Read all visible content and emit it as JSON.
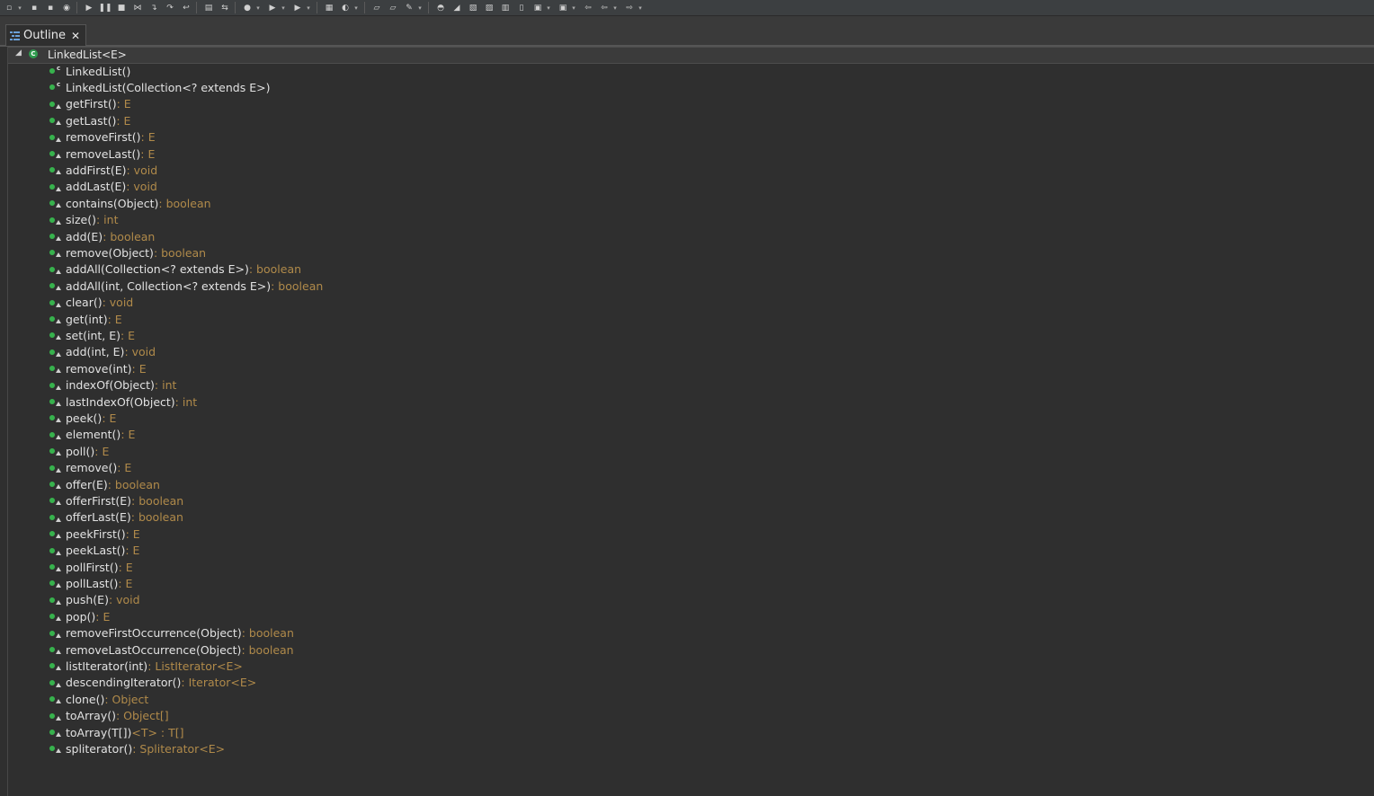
{
  "toolbar": {
    "buttons": [
      {
        "icon": "new-icon",
        "glyph": "▫",
        "dropdown": true
      },
      {
        "icon": "save-icon",
        "glyph": "▪"
      },
      {
        "icon": "save-all-icon",
        "glyph": "▪"
      },
      {
        "icon": "print-icon",
        "glyph": "◉"
      },
      {
        "sep": true
      },
      {
        "icon": "resume-icon",
        "glyph": "▶"
      },
      {
        "icon": "suspend-icon",
        "glyph": "❚❚"
      },
      {
        "icon": "terminate-icon",
        "glyph": "■"
      },
      {
        "icon": "disconnect-icon",
        "glyph": "⋈"
      },
      {
        "icon": "step-into-icon",
        "glyph": "↴"
      },
      {
        "icon": "step-over-icon",
        "glyph": "↷"
      },
      {
        "icon": "step-return-icon",
        "glyph": "↩"
      },
      {
        "sep": true
      },
      {
        "icon": "open-console-icon",
        "glyph": "▤"
      },
      {
        "icon": "use-step-filters-icon",
        "glyph": "⇆"
      },
      {
        "sep": true
      },
      {
        "icon": "debug-icon",
        "glyph": "●",
        "dropdown": true
      },
      {
        "icon": "run-icon",
        "glyph": "▶",
        "dropdown": true
      },
      {
        "icon": "external-tools-icon",
        "glyph": "▶",
        "dropdown": true
      },
      {
        "sep": true
      },
      {
        "icon": "new-java-project-icon",
        "glyph": "▦"
      },
      {
        "icon": "new-class-icon",
        "glyph": "◐",
        "dropdown": true
      },
      {
        "sep": true
      },
      {
        "icon": "open-type-icon",
        "glyph": "▱"
      },
      {
        "icon": "open-task-icon",
        "glyph": "▱"
      },
      {
        "icon": "search-icon",
        "glyph": "✎",
        "dropdown": true
      },
      {
        "sep": true
      },
      {
        "icon": "toggle-breadcrumb-icon",
        "glyph": "◓"
      },
      {
        "icon": "toggle-mark-occurrences-icon",
        "glyph": "◢"
      },
      {
        "icon": "toggle-block-selection-icon",
        "glyph": "▧"
      },
      {
        "icon": "show-whitespace-icon",
        "glyph": "▨"
      },
      {
        "icon": "show-source-icon",
        "glyph": "▥"
      },
      {
        "icon": "show-selected-element-icon",
        "glyph": "▯"
      },
      {
        "icon": "next-annotation-icon",
        "glyph": "▣",
        "dropdown": true
      },
      {
        "icon": "previous-annotation-icon",
        "glyph": "▣",
        "dropdown": true
      },
      {
        "icon": "last-edit-location-icon",
        "glyph": "⇦"
      },
      {
        "icon": "back-icon",
        "glyph": "⇦",
        "dropdown": true
      },
      {
        "icon": "forward-icon",
        "glyph": "⇨",
        "dropdown": true
      }
    ]
  },
  "view": {
    "tab_label": "Outline",
    "close_glyph": "✕"
  },
  "outline": {
    "root": {
      "label": "LinkedList<E>",
      "twisty": "◢",
      "icon": "class-icon",
      "icon_glyph": "C"
    },
    "members": [
      {
        "name": "LinkedList()",
        "ret": "",
        "kind": "constructor"
      },
      {
        "name": "LinkedList(Collection<? extends E>)",
        "ret": "",
        "kind": "constructor"
      },
      {
        "name": "getFirst()",
        "ret": " : E",
        "kind": "method"
      },
      {
        "name": "getLast()",
        "ret": " : E",
        "kind": "method"
      },
      {
        "name": "removeFirst()",
        "ret": " : E",
        "kind": "method"
      },
      {
        "name": "removeLast()",
        "ret": " : E",
        "kind": "method"
      },
      {
        "name": "addFirst(E)",
        "ret": " : void",
        "kind": "method"
      },
      {
        "name": "addLast(E)",
        "ret": " : void",
        "kind": "method"
      },
      {
        "name": "contains(Object)",
        "ret": " : boolean",
        "kind": "method"
      },
      {
        "name": "size()",
        "ret": " : int",
        "kind": "method"
      },
      {
        "name": "add(E)",
        "ret": " : boolean",
        "kind": "method"
      },
      {
        "name": "remove(Object)",
        "ret": " : boolean",
        "kind": "method"
      },
      {
        "name": "addAll(Collection<? extends E>)",
        "ret": " : boolean",
        "kind": "method"
      },
      {
        "name": "addAll(int, Collection<? extends E>)",
        "ret": " : boolean",
        "kind": "method"
      },
      {
        "name": "clear()",
        "ret": " : void",
        "kind": "method"
      },
      {
        "name": "get(int)",
        "ret": " : E",
        "kind": "method"
      },
      {
        "name": "set(int, E)",
        "ret": " : E",
        "kind": "method"
      },
      {
        "name": "add(int, E)",
        "ret": " : void",
        "kind": "method"
      },
      {
        "name": "remove(int)",
        "ret": " : E",
        "kind": "method"
      },
      {
        "name": "indexOf(Object)",
        "ret": " : int",
        "kind": "method"
      },
      {
        "name": "lastIndexOf(Object)",
        "ret": " : int",
        "kind": "method"
      },
      {
        "name": "peek()",
        "ret": " : E",
        "kind": "method"
      },
      {
        "name": "element()",
        "ret": " : E",
        "kind": "method"
      },
      {
        "name": "poll()",
        "ret": " : E",
        "kind": "method"
      },
      {
        "name": "remove()",
        "ret": " : E",
        "kind": "method"
      },
      {
        "name": "offer(E)",
        "ret": " : boolean",
        "kind": "method"
      },
      {
        "name": "offerFirst(E)",
        "ret": " : boolean",
        "kind": "method"
      },
      {
        "name": "offerLast(E)",
        "ret": " : boolean",
        "kind": "method"
      },
      {
        "name": "peekFirst()",
        "ret": " : E",
        "kind": "method"
      },
      {
        "name": "peekLast()",
        "ret": " : E",
        "kind": "method"
      },
      {
        "name": "pollFirst()",
        "ret": " : E",
        "kind": "method"
      },
      {
        "name": "pollLast()",
        "ret": " : E",
        "kind": "method"
      },
      {
        "name": "push(E)",
        "ret": " : void",
        "kind": "method"
      },
      {
        "name": "pop()",
        "ret": " : E",
        "kind": "method"
      },
      {
        "name": "removeFirstOccurrence(Object)",
        "ret": " : boolean",
        "kind": "method"
      },
      {
        "name": "removeLastOccurrence(Object)",
        "ret": " : boolean",
        "kind": "method"
      },
      {
        "name": "listIterator(int)",
        "ret": " : ListIterator<E>",
        "kind": "method"
      },
      {
        "name": "descendingIterator()",
        "ret": " : Iterator<E>",
        "kind": "method"
      },
      {
        "name": "clone()",
        "ret": " : Object",
        "kind": "method"
      },
      {
        "name": "toArray()",
        "ret": " : Object[]",
        "kind": "method"
      },
      {
        "name": "toArray(T[])",
        "ret": " <T> : T[]",
        "kind": "method"
      },
      {
        "name": "spliterator()",
        "ret": " : Spliterator<E>",
        "kind": "method"
      }
    ]
  }
}
